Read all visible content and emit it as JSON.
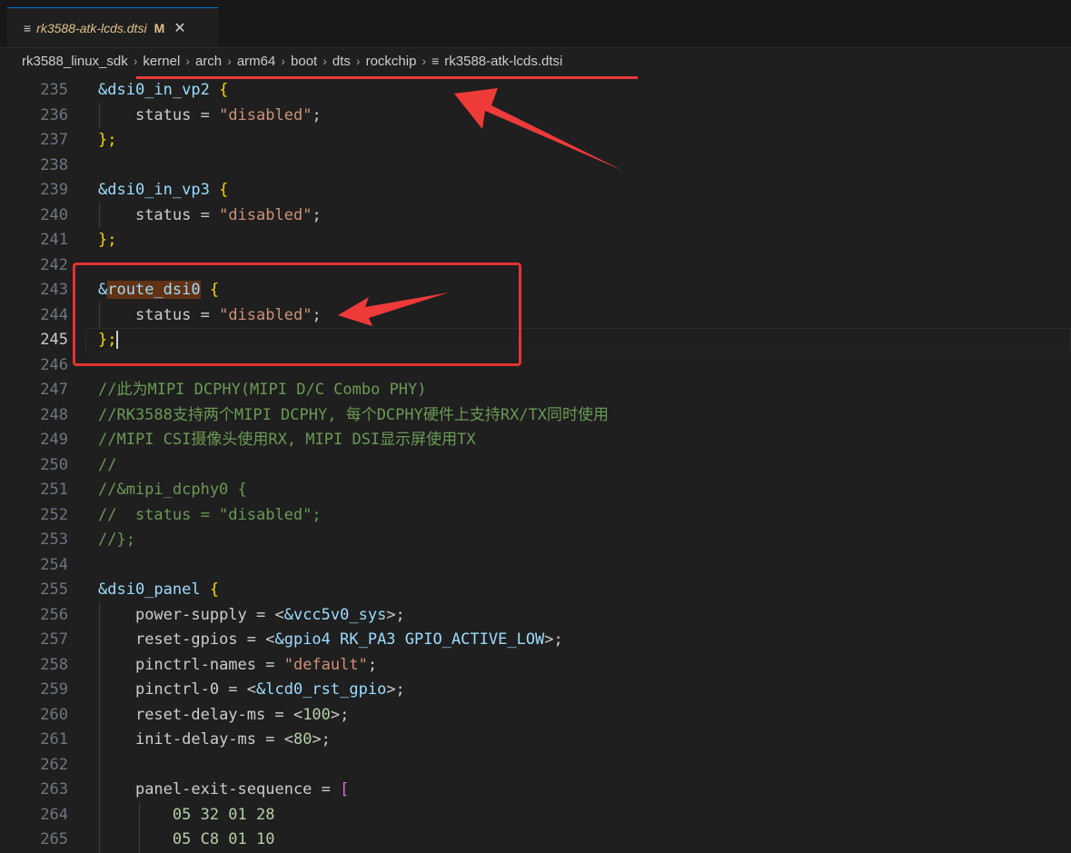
{
  "tab": {
    "file_icon": "≡",
    "label": "rk3588-atk-lcds.dtsi",
    "modified": "M",
    "close": "✕"
  },
  "breadcrumb": {
    "items": [
      "rk3588_linux_sdk",
      "kernel",
      "arch",
      "arm64",
      "boot",
      "dts",
      "rockchip"
    ],
    "file": "rk3588-atk-lcds.dtsi",
    "separator": "›",
    "file_icon": "≡"
  },
  "editor": {
    "active_line": 245,
    "lines": [
      {
        "n": "235"
      },
      {
        "n": "236"
      },
      {
        "n": "237"
      },
      {
        "n": "238"
      },
      {
        "n": "239"
      },
      {
        "n": "240"
      },
      {
        "n": "241"
      },
      {
        "n": "242"
      },
      {
        "n": "243"
      },
      {
        "n": "244"
      },
      {
        "n": "245"
      },
      {
        "n": "246"
      },
      {
        "n": "247"
      },
      {
        "n": "248"
      },
      {
        "n": "249"
      },
      {
        "n": "250"
      },
      {
        "n": "251"
      },
      {
        "n": "252"
      },
      {
        "n": "253"
      },
      {
        "n": "254"
      },
      {
        "n": "255"
      },
      {
        "n": "256"
      },
      {
        "n": "257"
      },
      {
        "n": "258"
      },
      {
        "n": "259"
      },
      {
        "n": "260"
      },
      {
        "n": "261"
      },
      {
        "n": "262"
      },
      {
        "n": "263"
      },
      {
        "n": "264"
      },
      {
        "n": "265"
      }
    ],
    "code": {
      "l235": {
        "node": "&dsi0_in_vp2",
        "brace": "{"
      },
      "l236": {
        "prop": "status = ",
        "val": "\"disabled\"",
        "end": ";"
      },
      "l237": {
        "text": "};"
      },
      "l239": {
        "node": "&dsi0_in_vp3",
        "brace": "{"
      },
      "l240": {
        "prop": "status = ",
        "val": "\"disabled\"",
        "end": ";"
      },
      "l241": {
        "text": "};"
      },
      "l243": {
        "amp": "&",
        "node": "route_dsi0",
        "brace": "{"
      },
      "l244": {
        "prop": "status = ",
        "val": "\"disabled\"",
        "end": ";"
      },
      "l245": {
        "text": "};"
      },
      "l247": "//此为MIPI DCPHY(MIPI D/C Combo PHY)",
      "l248": "//RK3588支持两个MIPI DCPHY, 每个DCPHY硬件上支持RX/TX同时使用",
      "l249": "//MIPI CSI摄像头使用RX, MIPI DSI显示屏使用TX",
      "l250": "//",
      "l251": "//&mipi_dcphy0 {",
      "l252": "//  status = \"disabled\";",
      "l253": "//};",
      "l255": {
        "node": "&dsi0_panel",
        "brace": "{"
      },
      "l256": {
        "prop": "power-supply = <",
        "ref": "&vcc5v0_sys",
        "end": ">;"
      },
      "l257": {
        "prop": "reset-gpios = <",
        "ref": "&gpio4 RK_PA3 GPIO_ACTIVE_LOW",
        "end": ">;"
      },
      "l258": {
        "prop": "pinctrl-names = ",
        "val": "\"default\"",
        "end": ";"
      },
      "l259": {
        "prop": "pinctrl-0 = <",
        "ref": "&lcd0_rst_gpio",
        "end": ">;"
      },
      "l260": {
        "prop": "reset-delay-ms = <",
        "num": "100",
        "end": ">;"
      },
      "l261": {
        "prop": "init-delay-ms = <",
        "num": "80",
        "end": ">;"
      },
      "l263": {
        "prop": "panel-exit-sequence = ",
        "bracket": "["
      },
      "l264": {
        "num": "05 32 01 28"
      },
      "l265": {
        "num": "05 C8 01 10"
      }
    }
  },
  "colors": {
    "annotation_red": "#e63232",
    "editor_bg": "#1f1f1f",
    "tab_accent": "#0078d4"
  }
}
